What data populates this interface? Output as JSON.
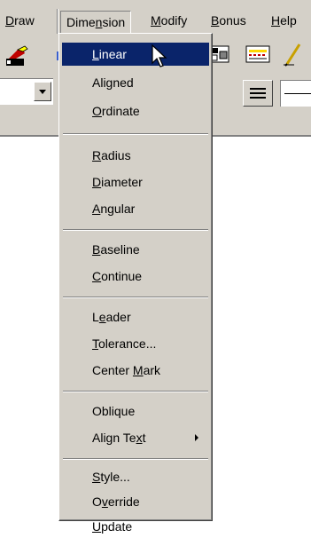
{
  "menubar": {
    "items": [
      {
        "pre": "",
        "key": "D",
        "post": "raw"
      },
      {
        "pre": "Dime",
        "key": "n",
        "post": "sion"
      },
      {
        "pre": "",
        "key": "M",
        "post": "odify"
      },
      {
        "pre": "",
        "key": "B",
        "post": "onus"
      },
      {
        "pre": "",
        "key": "H",
        "post": "elp"
      }
    ]
  },
  "menu": {
    "items": [
      {
        "pre": "",
        "key": "L",
        "post": "inear",
        "highlighted": true
      },
      {
        "pre": "Aligned",
        "key": "",
        "post": ""
      },
      {
        "pre": "",
        "key": "O",
        "post": "rdinate"
      },
      {
        "pre": "",
        "key": "R",
        "post": "adius"
      },
      {
        "pre": "",
        "key": "D",
        "post": "iameter"
      },
      {
        "pre": "",
        "key": "A",
        "post": "ngular"
      },
      {
        "pre": "",
        "key": "B",
        "post": "aseline"
      },
      {
        "pre": "",
        "key": "C",
        "post": "ontinue"
      },
      {
        "pre": "L",
        "key": "e",
        "post": "ader"
      },
      {
        "pre": "",
        "key": "T",
        "post": "olerance..."
      },
      {
        "pre": "Center ",
        "key": "M",
        "post": "ark"
      },
      {
        "pre": "Oblique",
        "key": "",
        "post": ""
      },
      {
        "pre": "Align Te",
        "key": "x",
        "post": "t",
        "submenu": true
      },
      {
        "pre": "",
        "key": "S",
        "post": "tyle..."
      },
      {
        "pre": "O",
        "key": "v",
        "post": "erride"
      },
      {
        "pre": "",
        "key": "U",
        "post": "pdate"
      }
    ]
  },
  "colors": {
    "face": "#d4d0c8",
    "highlight": "#0a246a",
    "highlight_text": "#ffffff"
  },
  "icons": [
    "paint-brush-icon",
    "block-icon",
    "layers-icon",
    "pencil-icon",
    "linetype-icon",
    "mouse-cursor-icon",
    "submenu-arrow-icon",
    "dropdown-arrow-icon"
  ]
}
